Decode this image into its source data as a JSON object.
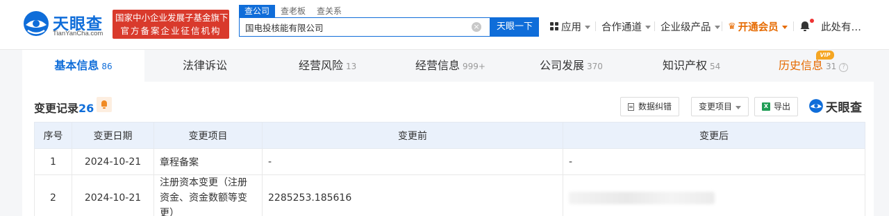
{
  "brand": {
    "name_cn": "天眼查",
    "name_en": "TianYanCha.com",
    "badge_line1": "国家中小企业发展子基金旗下",
    "badge_line2": "官方备案企业征信机构"
  },
  "search": {
    "tabs": [
      "查公司",
      "查老板",
      "查关系"
    ],
    "active_tab": "查公司",
    "value": "国电投核能有限公司",
    "button_label": "天眼一下",
    "clear_icon": "×"
  },
  "nav": {
    "apps": "应用",
    "channels": "合作通道",
    "enterprise": "企业级产品",
    "vip": "开通会员",
    "user": "此处有…"
  },
  "tabs": [
    {
      "label": "基本信息",
      "count": "86"
    },
    {
      "label": "法律诉讼",
      "count": ""
    },
    {
      "label": "经营风险",
      "count": "13"
    },
    {
      "label": "经营信息",
      "count": "999+"
    },
    {
      "label": "公司发展",
      "count": "370"
    },
    {
      "label": "知识产权",
      "count": "54"
    },
    {
      "label": "历史信息",
      "count": "31"
    }
  ],
  "vip_tag": "VIP",
  "section": {
    "title": "变更记录",
    "count": "26",
    "feedback_label": "数据纠错",
    "filter_label": "变更项目",
    "export_label": "导出",
    "logo_text": "天眼查"
  },
  "table": {
    "headers": [
      "序号",
      "变更日期",
      "变更项目",
      "变更前",
      "变更后"
    ],
    "rows": [
      {
        "index": "1",
        "date": "2024-10-21",
        "item": "章程备案",
        "before": "-",
        "after": "-"
      },
      {
        "index": "2",
        "date": "2024-10-21",
        "item": "注册资本变更（注册资金、资金数额等变更）",
        "before": "2285253.185616",
        "after": ""
      }
    ]
  },
  "colors": {
    "brand_blue": "#0f6dd9",
    "badge_red": "#d93a2c",
    "vip_orange": "#e66a00"
  }
}
